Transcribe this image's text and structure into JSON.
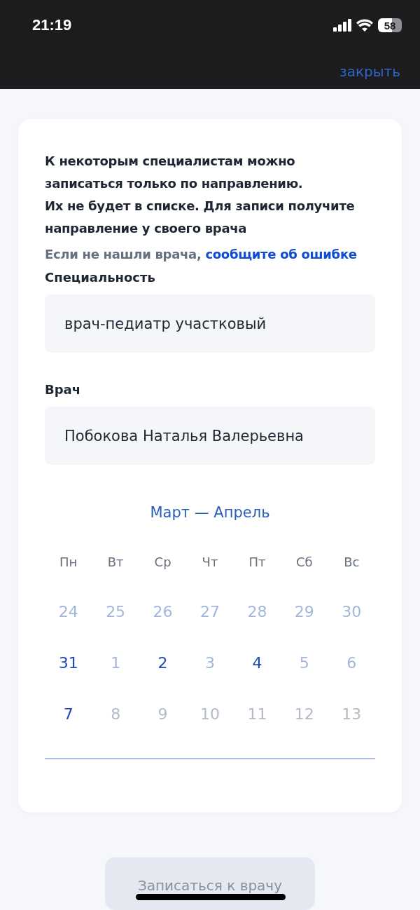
{
  "status_bar": {
    "time": "21:19",
    "battery": "58"
  },
  "header": {
    "close": "закрыть"
  },
  "notice": "К некоторым специалистам можно записаться только по направлению.\nИх не будет в списке. Для записи получите направление у своего врача",
  "report": {
    "text": "Если не нашли врача,",
    "link": "сообщите об ошибке"
  },
  "fields": [
    {
      "label": "Специальность",
      "value": "врач-педиатр участковый"
    },
    {
      "label": "Врач",
      "value": "Побокова Наталья Валерьевна"
    }
  ],
  "calendar": {
    "title": "Март — Апрель",
    "weekdays": [
      "Пн",
      "Вт",
      "Ср",
      "Чт",
      "Пт",
      "Сб",
      "Вс"
    ],
    "weeks": [
      [
        {
          "day": "24",
          "kind": "past"
        },
        {
          "day": "25",
          "kind": "past"
        },
        {
          "day": "26",
          "kind": "past"
        },
        {
          "day": "27",
          "kind": "past"
        },
        {
          "day": "28",
          "kind": "past"
        },
        {
          "day": "29",
          "kind": "past"
        },
        {
          "day": "30",
          "kind": "past"
        }
      ],
      [
        {
          "day": "31",
          "kind": "available"
        },
        {
          "day": "1",
          "kind": "past"
        },
        {
          "day": "2",
          "kind": "available"
        },
        {
          "day": "3",
          "kind": "past"
        },
        {
          "day": "4",
          "kind": "available"
        },
        {
          "day": "5",
          "kind": "past"
        },
        {
          "day": "6",
          "kind": "past"
        }
      ],
      [
        {
          "day": "7",
          "kind": "available"
        },
        {
          "day": "8",
          "kind": "closed"
        },
        {
          "day": "9",
          "kind": "closed"
        },
        {
          "day": "10",
          "kind": "closed"
        },
        {
          "day": "11",
          "kind": "closed"
        },
        {
          "day": "12",
          "kind": "closed"
        },
        {
          "day": "13",
          "kind": "closed"
        }
      ]
    ]
  },
  "submit": {
    "label": "Записаться к врачу",
    "disabled": true
  }
}
